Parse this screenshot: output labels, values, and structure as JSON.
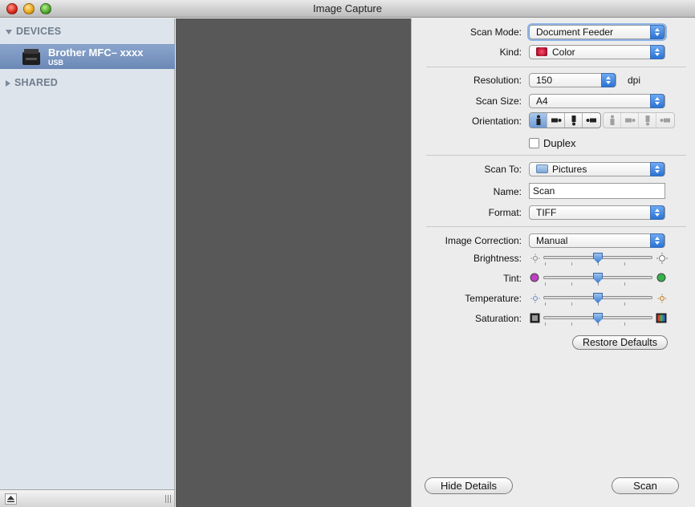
{
  "window": {
    "title": "Image Capture"
  },
  "sidebar": {
    "devices_header": "DEVICES",
    "shared_header": "SHARED",
    "device": {
      "name": "Brother  MFC– xxxx",
      "connection": "USB"
    }
  },
  "settings": {
    "scan_mode": {
      "label": "Scan Mode:",
      "value": "Document Feeder"
    },
    "kind": {
      "label": "Kind:",
      "value": "Color"
    },
    "resolution": {
      "label": "Resolution:",
      "value": "150",
      "unit": "dpi"
    },
    "scan_size": {
      "label": "Scan Size:",
      "value": "A4"
    },
    "orientation": {
      "label": "Orientation:",
      "selected_index": 0
    },
    "duplex": {
      "label": "Duplex",
      "checked": false
    },
    "scan_to": {
      "label": "Scan To:",
      "value": "Pictures"
    },
    "name": {
      "label": "Name:",
      "value": "Scan"
    },
    "format": {
      "label": "Format:",
      "value": "TIFF"
    },
    "image_correction": {
      "label": "Image Correction:",
      "value": "Manual"
    },
    "sliders": [
      {
        "label": "Brightness:",
        "value": 0.5
      },
      {
        "label": "Tint:",
        "value": 0.5
      },
      {
        "label": "Temperature:",
        "value": 0.5
      },
      {
        "label": "Saturation:",
        "value": 0.5
      }
    ],
    "restore_defaults": "Restore Defaults"
  },
  "footer": {
    "hide_details": "Hide Details",
    "scan": "Scan"
  },
  "colors": {
    "accent": "#3f7fd2",
    "sidebar_bg": "#dde4ec",
    "sidebar_selection": "#6b88b6",
    "preview_bg": "#585858"
  }
}
